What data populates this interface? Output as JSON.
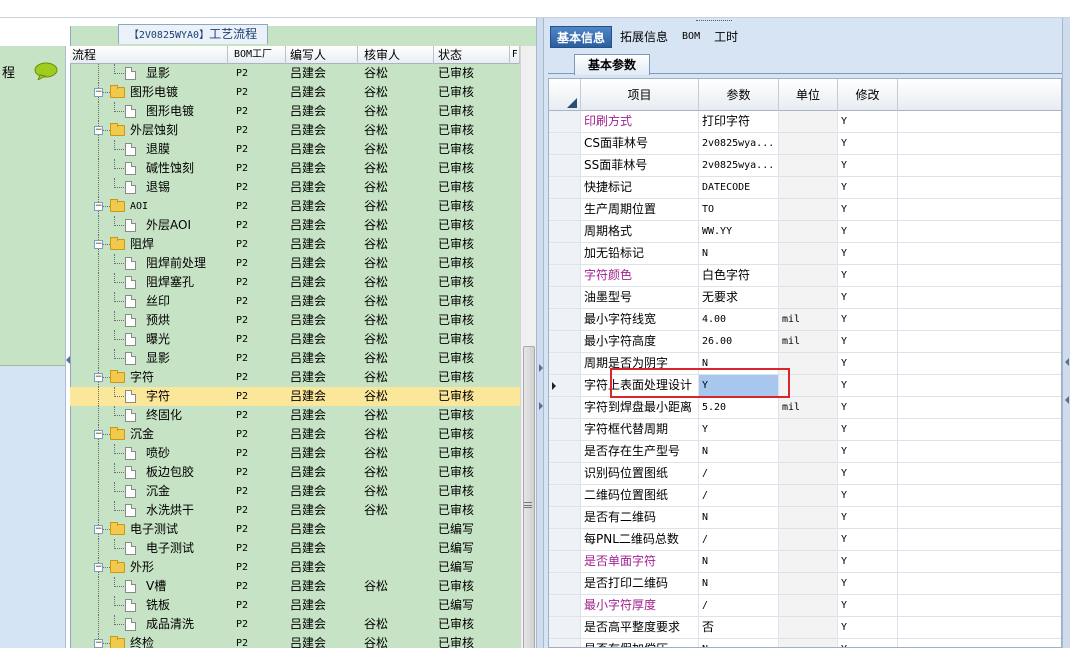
{
  "left_panel": {
    "label": "程"
  },
  "middle": {
    "title_code": "【2V0825WYA0】",
    "title_text": "工艺流程",
    "columns": {
      "name": "流程",
      "bom": "BOM工厂",
      "writer": "编写人",
      "reviewer": "核审人",
      "status": "状态",
      "extra": "F"
    },
    "rows": [
      {
        "depth": 2,
        "type": "doc",
        "name": "显影",
        "bom": "P2",
        "writer": "吕建会",
        "reviewer": "谷松",
        "status": "已审核"
      },
      {
        "depth": 1,
        "type": "folder",
        "name": "图形电镀",
        "bom": "P2",
        "writer": "吕建会",
        "reviewer": "谷松",
        "status": "已审核"
      },
      {
        "depth": 2,
        "type": "doc",
        "name": "图形电镀",
        "bom": "P2",
        "writer": "吕建会",
        "reviewer": "谷松",
        "status": "已审核"
      },
      {
        "depth": 1,
        "type": "folder",
        "name": "外层蚀刻",
        "bom": "P2",
        "writer": "吕建会",
        "reviewer": "谷松",
        "status": "已审核"
      },
      {
        "depth": 2,
        "type": "doc",
        "name": "退膜",
        "bom": "P2",
        "writer": "吕建会",
        "reviewer": "谷松",
        "status": "已审核"
      },
      {
        "depth": 2,
        "type": "doc",
        "name": "碱性蚀刻",
        "bom": "P2",
        "writer": "吕建会",
        "reviewer": "谷松",
        "status": "已审核"
      },
      {
        "depth": 2,
        "type": "doc",
        "name": "退锡",
        "bom": "P2",
        "writer": "吕建会",
        "reviewer": "谷松",
        "status": "已审核"
      },
      {
        "depth": 1,
        "type": "folder",
        "name": "AOI",
        "bom": "P2",
        "writer": "吕建会",
        "reviewer": "谷松",
        "status": "已审核",
        "mono": true
      },
      {
        "depth": 2,
        "type": "doc",
        "name": "外层AOI",
        "bom": "P2",
        "writer": "吕建会",
        "reviewer": "谷松",
        "status": "已审核"
      },
      {
        "depth": 1,
        "type": "folder",
        "name": "阻焊",
        "bom": "P2",
        "writer": "吕建会",
        "reviewer": "谷松",
        "status": "已审核"
      },
      {
        "depth": 2,
        "type": "doc",
        "name": "阻焊前处理",
        "bom": "P2",
        "writer": "吕建会",
        "reviewer": "谷松",
        "status": "已审核"
      },
      {
        "depth": 2,
        "type": "doc",
        "name": "阻焊塞孔",
        "bom": "P2",
        "writer": "吕建会",
        "reviewer": "谷松",
        "status": "已审核"
      },
      {
        "depth": 2,
        "type": "doc",
        "name": "丝印",
        "bom": "P2",
        "writer": "吕建会",
        "reviewer": "谷松",
        "status": "已审核"
      },
      {
        "depth": 2,
        "type": "doc",
        "name": "预烘",
        "bom": "P2",
        "writer": "吕建会",
        "reviewer": "谷松",
        "status": "已审核"
      },
      {
        "depth": 2,
        "type": "doc",
        "name": "曝光",
        "bom": "P2",
        "writer": "吕建会",
        "reviewer": "谷松",
        "status": "已审核"
      },
      {
        "depth": 2,
        "type": "doc",
        "name": "显影",
        "bom": "P2",
        "writer": "吕建会",
        "reviewer": "谷松",
        "status": "已审核"
      },
      {
        "depth": 1,
        "type": "folder",
        "name": "字符",
        "bom": "P2",
        "writer": "吕建会",
        "reviewer": "谷松",
        "status": "已审核"
      },
      {
        "depth": 2,
        "type": "doc",
        "name": "字符",
        "bom": "P2",
        "writer": "吕建会",
        "reviewer": "谷松",
        "status": "已审核",
        "selected": true
      },
      {
        "depth": 2,
        "type": "doc",
        "name": "终固化",
        "bom": "P2",
        "writer": "吕建会",
        "reviewer": "谷松",
        "status": "已审核"
      },
      {
        "depth": 1,
        "type": "folder",
        "name": "沉金",
        "bom": "P2",
        "writer": "吕建会",
        "reviewer": "谷松",
        "status": "已审核"
      },
      {
        "depth": 2,
        "type": "doc",
        "name": "喷砂",
        "bom": "P2",
        "writer": "吕建会",
        "reviewer": "谷松",
        "status": "已审核"
      },
      {
        "depth": 2,
        "type": "doc",
        "name": "板边包胶",
        "bom": "P2",
        "writer": "吕建会",
        "reviewer": "谷松",
        "status": "已审核"
      },
      {
        "depth": 2,
        "type": "doc",
        "name": "沉金",
        "bom": "P2",
        "writer": "吕建会",
        "reviewer": "谷松",
        "status": "已审核"
      },
      {
        "depth": 2,
        "type": "doc",
        "name": "水洗烘干",
        "bom": "P2",
        "writer": "吕建会",
        "reviewer": "谷松",
        "status": "已审核"
      },
      {
        "depth": 1,
        "type": "folder",
        "name": "电子测试",
        "bom": "P2",
        "writer": "吕建会",
        "reviewer": "",
        "status": "已编写"
      },
      {
        "depth": 2,
        "type": "doc",
        "name": "电子测试",
        "bom": "P2",
        "writer": "吕建会",
        "reviewer": "",
        "status": "已编写"
      },
      {
        "depth": 1,
        "type": "folder",
        "name": "外形",
        "bom": "P2",
        "writer": "吕建会",
        "reviewer": "",
        "status": "已编写"
      },
      {
        "depth": 2,
        "type": "doc",
        "name": "V槽",
        "bom": "P2",
        "writer": "吕建会",
        "reviewer": "谷松",
        "status": "已审核"
      },
      {
        "depth": 2,
        "type": "doc",
        "name": "铣板",
        "bom": "P2",
        "writer": "吕建会",
        "reviewer": "",
        "status": "已编写"
      },
      {
        "depth": 2,
        "type": "doc",
        "name": "成品清洗",
        "bom": "P2",
        "writer": "吕建会",
        "reviewer": "谷松",
        "status": "已审核"
      },
      {
        "depth": 1,
        "type": "folder",
        "name": "终检",
        "bom": "P2",
        "writer": "吕建会",
        "reviewer": "谷松",
        "status": "已审核"
      }
    ]
  },
  "right": {
    "tabs": [
      {
        "label": "基本信息",
        "active": true
      },
      {
        "label": "拓展信息",
        "active": false
      },
      {
        "label": "BOM",
        "active": false,
        "mono": true
      },
      {
        "label": "工时",
        "active": false
      }
    ],
    "subtab": "基本参数",
    "columns": {
      "item": "项目",
      "param": "参数",
      "unit": "单位",
      "modify": "修改"
    },
    "rows": [
      {
        "item": "印刷方式",
        "param": "打印字符",
        "unit": "",
        "modify": "Y",
        "hl": true
      },
      {
        "item": "CS面菲林号",
        "param": "2v0825wya...",
        "unit": "",
        "modify": "Y"
      },
      {
        "item": "SS面菲林号",
        "param": "2v0825wya...",
        "unit": "",
        "modify": "Y"
      },
      {
        "item": "快捷标记",
        "param": "DATECODE",
        "unit": "",
        "modify": "Y"
      },
      {
        "item": "生产周期位置",
        "param": "TO",
        "unit": "",
        "modify": "Y"
      },
      {
        "item": "周期格式",
        "param": "WW.YY",
        "unit": "",
        "modify": "Y"
      },
      {
        "item": "加无铅标记",
        "param": "N",
        "unit": "",
        "modify": "Y"
      },
      {
        "item": "字符颜色",
        "param": "白色字符",
        "unit": "",
        "modify": "Y",
        "hl": true
      },
      {
        "item": "油墨型号",
        "param": "无要求",
        "unit": "",
        "modify": "Y"
      },
      {
        "item": "最小字符线宽",
        "param": "4.00",
        "unit": "mil",
        "modify": "Y"
      },
      {
        "item": "最小字符高度",
        "param": "26.00",
        "unit": "mil",
        "modify": "Y"
      },
      {
        "item": "周期是否为阴字",
        "param": "N",
        "unit": "",
        "modify": "Y"
      },
      {
        "item": "字符上表面处理设计",
        "param": "Y",
        "unit": "",
        "modify": "Y",
        "current": true
      },
      {
        "item": "字符到焊盘最小距离",
        "param": "5.20",
        "unit": "mil",
        "modify": "Y"
      },
      {
        "item": "字符框代替周期",
        "param": "Y",
        "unit": "",
        "modify": "Y"
      },
      {
        "item": "是否存在生产型号",
        "param": "N",
        "unit": "",
        "modify": "Y"
      },
      {
        "item": "识别码位置图纸",
        "param": "/",
        "unit": "",
        "modify": "Y"
      },
      {
        "item": "二维码位置图纸",
        "param": "/",
        "unit": "",
        "modify": "Y"
      },
      {
        "item": "是否有二维码",
        "param": "N",
        "unit": "",
        "modify": "Y"
      },
      {
        "item": "每PNL二维码总数",
        "param": "/",
        "unit": "",
        "modify": "Y"
      },
      {
        "item": "是否单面字符",
        "param": "N",
        "unit": "",
        "modify": "Y",
        "hl": true
      },
      {
        "item": "是否打印二维码",
        "param": "N",
        "unit": "",
        "modify": "Y"
      },
      {
        "item": "最小字符厚度",
        "param": "/",
        "unit": "",
        "modify": "Y",
        "hl": true
      },
      {
        "item": "是否高平整度要求",
        "param": "否",
        "unit": "",
        "modify": "Y"
      },
      {
        "item": "是否有假加偿压",
        "param": "N",
        "unit": "",
        "modify": "Y"
      }
    ]
  },
  "colors": {
    "accent": "#2a5f9e",
    "tree_bg": "#c7e3c5",
    "selected_row": "#fbe79a",
    "highlight_text": "#a0208f",
    "annotation": "#d9262c"
  }
}
